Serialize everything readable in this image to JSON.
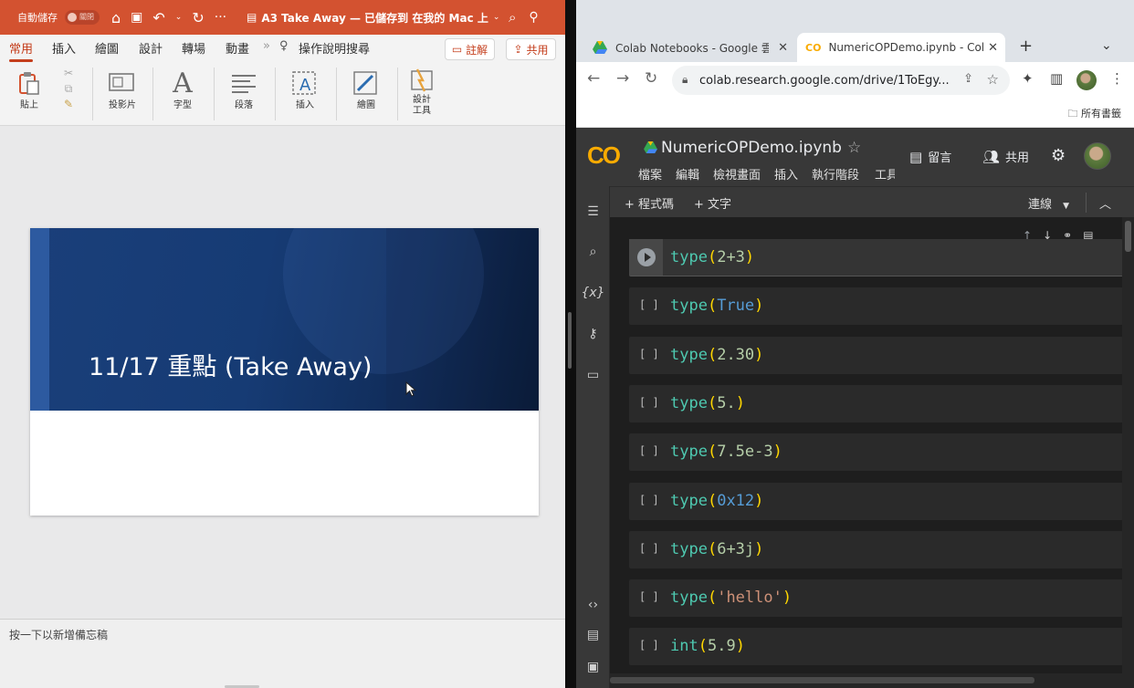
{
  "ppt": {
    "titlebar": {
      "autosave_label": "自動儲存",
      "autosave_state": "關閉",
      "document_title": "A3 Take Away — 已儲存到 在我的 Mac 上",
      "more": "···"
    },
    "tabs": [
      {
        "label": "常用",
        "active": true
      },
      {
        "label": "插入"
      },
      {
        "label": "繪圖"
      },
      {
        "label": "設計"
      },
      {
        "label": "轉場"
      },
      {
        "label": "動畫"
      },
      {
        "label": "操作說明搜尋"
      }
    ],
    "comment_label": "註解",
    "share_label": "共用",
    "ribbon": {
      "paste": "貼上",
      "slides": "投影片",
      "font": "字型",
      "paragraph": "段落",
      "insert": "插入",
      "draw": "繪圖",
      "designer_line1": "設計",
      "designer_line2": "工具"
    },
    "slide": {
      "title": "11/17 重點 (Take Away)"
    },
    "notes_placeholder": "按一下以新增備忘稿"
  },
  "chrome": {
    "tabs": [
      {
        "title": "Colab Notebooks - Google 雲"
      },
      {
        "title": "NumericOPDemo.ipynb - Cola",
        "active": true
      }
    ],
    "url": "colab.research.google.com/drive/1ToEgy...",
    "bookmarks_label": "所有書籤"
  },
  "colab": {
    "logo": "CO",
    "notebook_name": "NumericOPDemo.ipynb",
    "menu": [
      "檔案",
      "編輯",
      "檢視畫面",
      "插入",
      "執行階段",
      "工具"
    ],
    "comment": "留言",
    "share": "共用",
    "add_code": "+ 程式碼",
    "add_text": "+ 文字",
    "connect": "連線",
    "run_marker": "[ ]",
    "cells": [
      {
        "code": "type(2+3)",
        "fn": "type",
        "arg": "2+3",
        "arg_type": "number",
        "focused": true
      },
      {
        "code": "type(True)",
        "fn": "type",
        "arg": "True",
        "arg_type": "bool"
      },
      {
        "code": "type(2.30)",
        "fn": "type",
        "arg": "2.30",
        "arg_type": "number"
      },
      {
        "code": "type(5.)",
        "fn": "type",
        "arg": "5.",
        "arg_type": "number"
      },
      {
        "code": "type(7.5e-3)",
        "fn": "type",
        "arg": "7.5e-3",
        "arg_type": "number"
      },
      {
        "code": "type(0x12)",
        "fn": "type",
        "arg": "0x12",
        "arg_type": "bool"
      },
      {
        "code": "type(6+3j)",
        "fn": "type",
        "arg": "6+3j",
        "arg_type": "number"
      },
      {
        "code": "type('hello')",
        "fn": "type",
        "arg": "'hello'",
        "arg_type": "string"
      },
      {
        "code": "int(5.9)",
        "fn": "int",
        "arg": "5.9",
        "arg_type": "number"
      }
    ]
  },
  "colors": {
    "ppt_accent": "#d35230",
    "colab_bg": "#1e1e1e",
    "code_keyword": "#4ec9b0",
    "code_number": "#b5cea8",
    "code_paren": "#ffd700",
    "code_string": "#ce9178"
  }
}
